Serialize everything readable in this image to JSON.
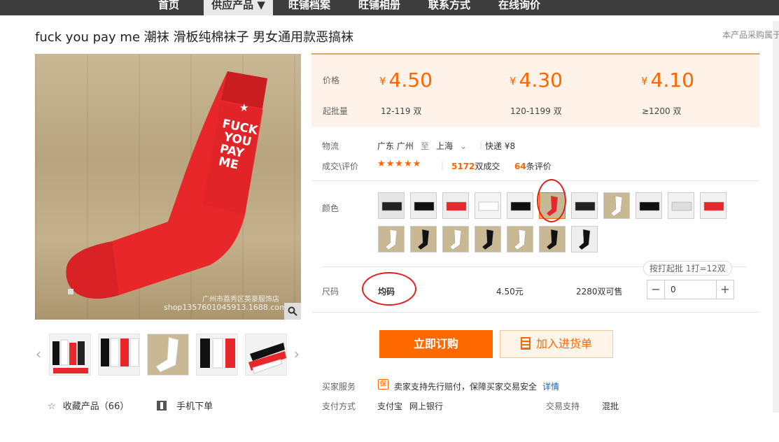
{
  "nav": {
    "items": [
      "首页",
      "供应产品 ▼",
      "旺铺档案",
      "旺铺相册",
      "联系方式",
      "在线询价"
    ],
    "active_index": 1
  },
  "product": {
    "title": "fuck you pay me 潮袜 滑板纯棉袜子 男女通用款恶搞袜",
    "title_right": "本产品采购属于",
    "watermark_line1": "广州市荔秀区英豪服饰店",
    "watermark_line2": "shop1357601045913.1688.com",
    "sock_print": [
      "FUCK",
      "YOU",
      "PAY",
      "ME"
    ]
  },
  "price": {
    "label_price": "价格",
    "label_moq": "起批量",
    "currency": "¥",
    "tiers": [
      {
        "price": "4.50",
        "moq": "12-119 双"
      },
      {
        "price": "4.30",
        "moq": "120-1199 双"
      },
      {
        "price": "4.10",
        "moq": "≥1200 双"
      }
    ]
  },
  "logistics": {
    "label": "物流",
    "from": "广东 广州",
    "to_word": "至",
    "to": "上海",
    "chevron": "chevron-down-icon",
    "express": "快递 ¥8"
  },
  "deals": {
    "label": "成交\\评价",
    "stars": "★★★★★",
    "count": "5172",
    "count_suffix": "双成交",
    "reviews": "64",
    "reviews_suffix": "条评价"
  },
  "color": {
    "label": "颜色",
    "swatch_count": 18,
    "selected_index": 5
  },
  "size": {
    "label": "尺码",
    "hint": "按打起批 1打=12双",
    "value": "均码",
    "price": "4.50元",
    "stock": "2280双可售",
    "qty": "0",
    "minus": "−",
    "plus": "+"
  },
  "actions": {
    "buy": "立即订购",
    "cart": "加入进货单",
    "cart_icon": "clipboard-icon"
  },
  "service": {
    "label": "买家服务",
    "badge": "保",
    "text": "卖家支持先行赔付，保障买家交易安全",
    "link": "详情"
  },
  "payment": {
    "label": "支付方式",
    "methods": [
      "支付宝",
      "网上银行"
    ],
    "trade_label": "交易支持",
    "trade_value": "混批"
  },
  "footer": {
    "fav": "收藏产品（66）",
    "fav_icon": "star-outline-icon",
    "mobile": "手机下单",
    "mobile_icon": "qr-code-icon"
  },
  "colors": {
    "accent": "#ff6a00",
    "price_bg": "#fff2e8",
    "nav_bg": "#3d3d3d"
  }
}
